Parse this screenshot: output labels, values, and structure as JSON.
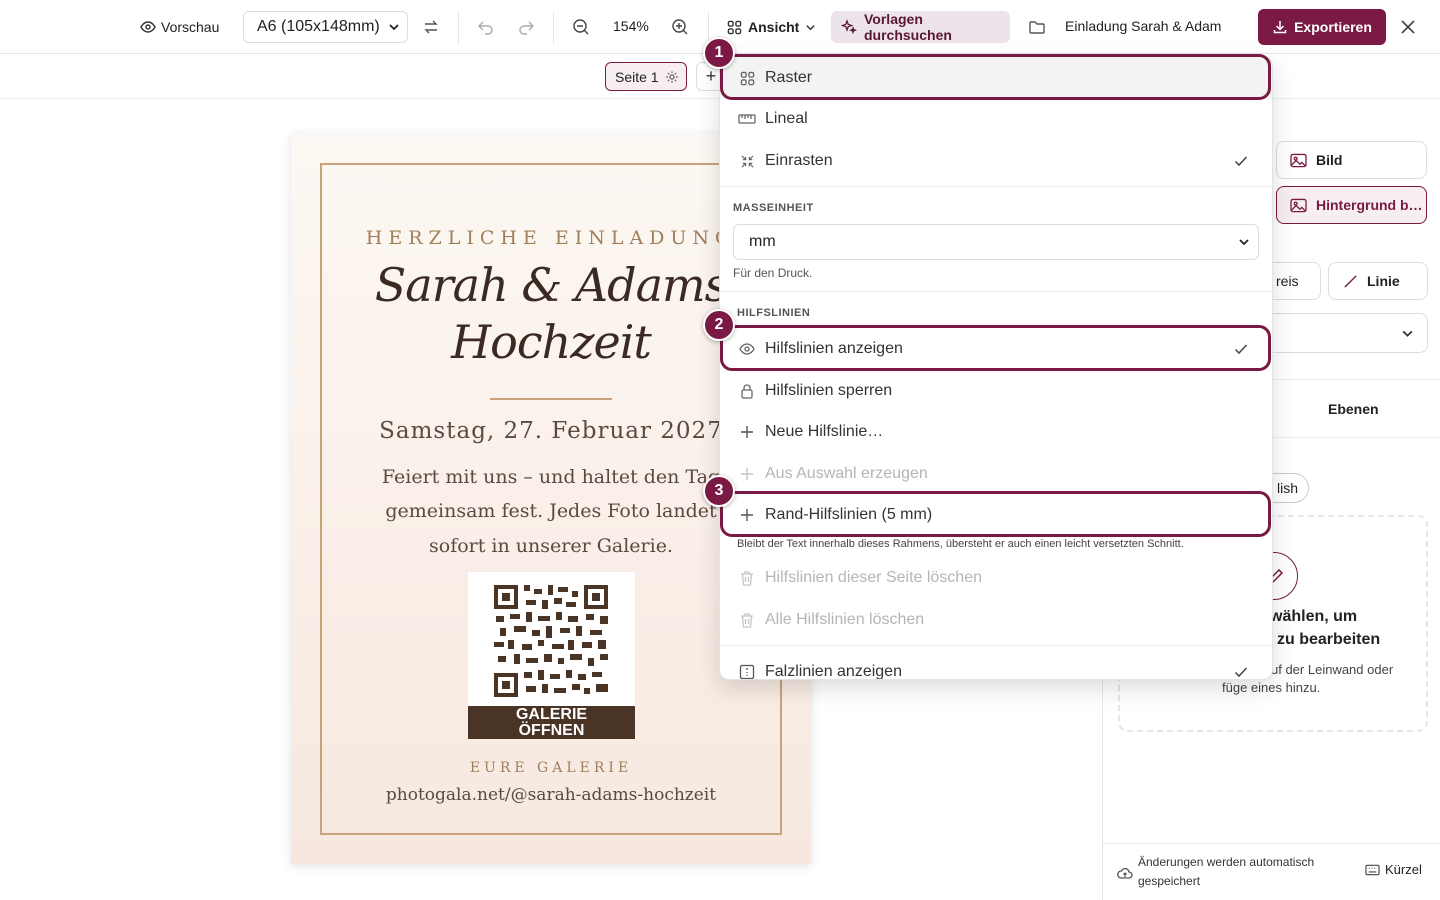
{
  "topbar": {
    "preview_label": "Vorschau",
    "format_value": "A6 (105x148mm)",
    "zoom_value": "154%",
    "view_label": "Ansicht",
    "templates_label": "Vorlagen durchsuchen",
    "project_name": "Einladung Sarah & Adam",
    "export_label": "Exportieren"
  },
  "subbar": {
    "page_label": "Seite 1",
    "add_glyph": "+"
  },
  "card": {
    "eyebrow": "HERZLICHE EINLADUNG",
    "title_line1": "Sarah & Adams",
    "title_line2": "Hochzeit",
    "date": "Samstag, 27. Februar 2027",
    "body_line1": "Feiert mit uns – und haltet den Tag",
    "body_line2": "gemeinsam fest. Jedes Foto landet",
    "body_line3": "sofort in unserer Galerie.",
    "qr_caption_line1": "GALERIE",
    "qr_caption_line2": "ÖFFNEN",
    "gallery_label": "EURE GALERIE",
    "url": "photogala.net/@sarah-adams-hochzeit",
    "accent_color": "#c9a27a",
    "qr_dark_color": "#4a3426"
  },
  "right_panel": {
    "image_button": "Bild",
    "background_button": "Hintergrund b…",
    "circle_button_partial": "reis",
    "line_button": "Linie",
    "layers_tab": "Ebenen",
    "language_pill_partial": "lish",
    "empty_title_line1": "wählen, um",
    "empty_title_line2": "zu bearbeiten",
    "empty_text_line1": "uf der Leinwand oder",
    "empty_text_line2": "füge eines hinzu.",
    "autosave_line1": "Änderungen werden automatisch",
    "autosave_line2": "gespeichert",
    "shortcuts_label": "Kürzel"
  },
  "menu": {
    "grid_label": "Raster",
    "ruler_label": "Lineal",
    "snap_label": "Einrasten",
    "unit_section": "MASSEINHEIT",
    "unit_value": "mm",
    "unit_hint": "Für den Druck.",
    "guides_section": "HILFSLINIEN",
    "show_guides_label": "Hilfslinien anzeigen",
    "lock_guides_label": "Hilfslinien sperren",
    "new_guide_label": "Neue Hilfslinie…",
    "from_selection_label": "Aus Auswahl erzeugen",
    "margin_guides_label": "Rand-Hilfslinien (5 mm)",
    "margin_hint": "Bleibt der Text innerhalb dieses Rahmens, übersteht er auch einen leicht versetzten Schnitt.",
    "delete_page_guides_label": "Hilfslinien dieser Seite löschen",
    "delete_all_guides_label": "Alle Hilfslinien löschen",
    "fold_lines_label": "Falzlinien anzeigen"
  },
  "steps": {
    "step1": "1",
    "step2": "2",
    "step3": "3"
  },
  "colors": {
    "brand": "#7a1a44",
    "templates_bg": "#ede3ea"
  }
}
